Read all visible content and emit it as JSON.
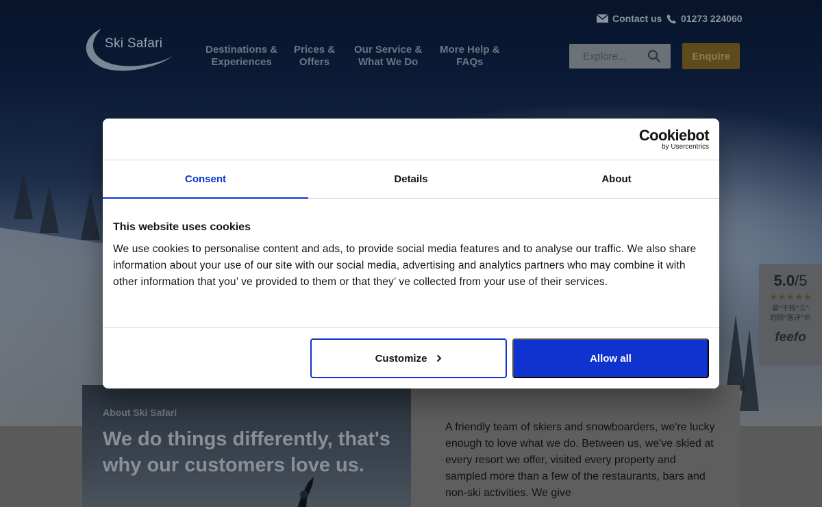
{
  "header": {
    "logo_text": "Ski Safari",
    "contact_label": "Contact us",
    "phone": "01273 224060",
    "nav": [
      {
        "line1": "Destinations &",
        "line2": "Experiences"
      },
      {
        "line1": "Prices &",
        "line2": "Offers"
      },
      {
        "line1": "Our Service &",
        "line2": "What We Do"
      },
      {
        "line1": "More Help &",
        "line2": "FAQs"
      }
    ],
    "search_placeholder": "Explore...",
    "enquire_label": "Enquire"
  },
  "feefo": {
    "score": "5.0",
    "out_of": "/5",
    "stars": "★★★★★",
    "rating": 5,
    "basis_line1": "基^于独^立^",
    "basis_line2": "的顾^客评^价",
    "logo": "feefo"
  },
  "about": {
    "label": "About Ski Safari",
    "title": "We do things differently, that's why our customers love us.",
    "body": "A friendly team of skiers and snowboarders, we're lucky enough to love what we do. Between us, we've skied at every resort we offer, visited every property and sampled more than a few of the restaurants, bars and non-ski activities. We give"
  },
  "cookie_dialog": {
    "brand": "Cookiebot",
    "brand_sub": "by Usercentrics",
    "tabs": [
      "Consent",
      "Details",
      "About"
    ],
    "active_tab": "Consent",
    "heading": "This website uses cookies",
    "text": "We use cookies to personalise content and ads, to provide social media features and to analyse our traffic. We also share information about your use of our site with our social media, advertising and analytics partners who may combine it with other information that you’ ve provided to them or that they’ ve collected from your use of their services.",
    "customize_label": "Customize",
    "allow_all_label": "Allow all",
    "accent_color": "#1032cf"
  }
}
